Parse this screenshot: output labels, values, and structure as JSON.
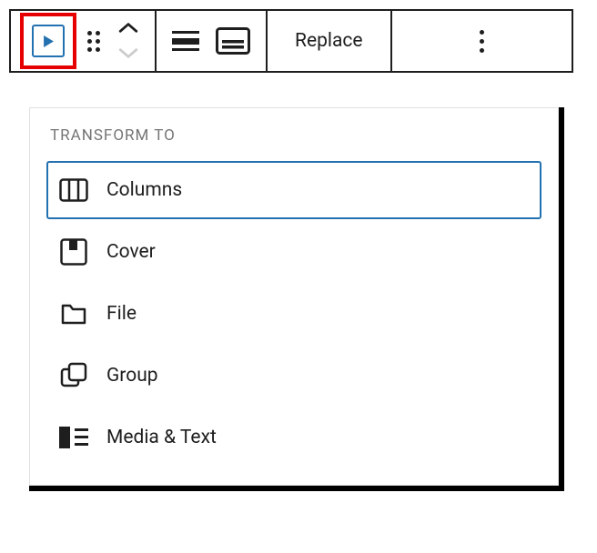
{
  "toolbar": {
    "block_icon": "video-block-icon",
    "drag_icon": "drag-handle-icon",
    "move_up_icon": "chevron-up-icon",
    "move_down_icon": "chevron-down-icon",
    "align_icon": "align-icon",
    "caption_icon": "caption-icon",
    "replace_label": "Replace",
    "more_icon": "more-vertical-icon"
  },
  "dropdown": {
    "header": "TRANSFORM TO",
    "items": [
      {
        "icon": "columns-icon",
        "label": "Columns",
        "selected": true
      },
      {
        "icon": "cover-icon",
        "label": "Cover",
        "selected": false
      },
      {
        "icon": "file-icon",
        "label": "File",
        "selected": false
      },
      {
        "icon": "group-icon",
        "label": "Group",
        "selected": false
      },
      {
        "icon": "media-text-icon",
        "label": "Media & Text",
        "selected": false
      }
    ]
  }
}
